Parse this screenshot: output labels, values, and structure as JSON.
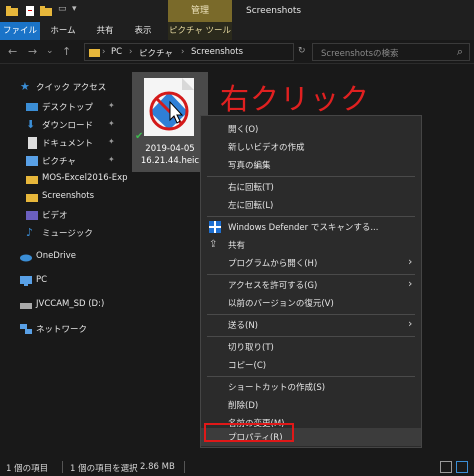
{
  "titlebar": {
    "manage_tab": "管理",
    "title": "Screenshots"
  },
  "ribbon_tabs": [
    "ファイル",
    "ホーム",
    "共有",
    "表示",
    "ピクチャ ツール"
  ],
  "address": {
    "path": [
      "PC",
      "ピクチャ",
      "Screenshots"
    ],
    "search_placeholder": "Screenshotsの検索"
  },
  "sidebar": {
    "items": [
      {
        "label": "クイック アクセス",
        "icon": "star-icon"
      },
      {
        "label": "デスクトップ",
        "icon": "desktop-icon",
        "pinned": "✦"
      },
      {
        "label": "ダウンロード",
        "icon": "download-icon",
        "pinned": "✦"
      },
      {
        "label": "ドキュメント",
        "icon": "document-icon",
        "pinned": "✦"
      },
      {
        "label": "ピクチャ",
        "icon": "pictures-icon",
        "pinned": "✦"
      },
      {
        "label": "MOS-Excel2016-Exp",
        "icon": "folder-icon"
      },
      {
        "label": "Screenshots",
        "icon": "folder-icon"
      },
      {
        "label": "ビデオ",
        "icon": "video-icon"
      },
      {
        "label": "ミュージック",
        "icon": "music-icon"
      },
      {
        "label": "OneDrive",
        "icon": "cloud-icon"
      },
      {
        "label": "PC",
        "icon": "pc-icon"
      },
      {
        "label": "JVCCAM_SD (D:)",
        "icon": "drive-icon"
      },
      {
        "label": "ネットワーク",
        "icon": "network-icon"
      }
    ]
  },
  "file": {
    "name_line1": "2019-04-05",
    "name_line2": "16.21.44.heic"
  },
  "annotation": "右クリック",
  "context_menu": {
    "items": [
      {
        "label": "開く(O)"
      },
      {
        "label": "新しいビデオの作成"
      },
      {
        "label": "写真の編集"
      },
      {
        "label": "右に回転(T)"
      },
      {
        "label": "左に回転(L)"
      },
      {
        "label": "Windows Defender でスキャンする...",
        "icon": "defender-icon"
      },
      {
        "label": "共有",
        "icon": "share-icon"
      },
      {
        "label": "プログラムから開く(H)",
        "submenu": "›"
      },
      {
        "label": "アクセスを許可する(G)",
        "submenu": "›"
      },
      {
        "label": "以前のバージョンの復元(V)"
      },
      {
        "label": "送る(N)",
        "submenu": "›"
      },
      {
        "label": "切り取り(T)"
      },
      {
        "label": "コピー(C)"
      },
      {
        "label": "ショートカットの作成(S)"
      },
      {
        "label": "削除(D)"
      },
      {
        "label": "名前の変更(M)"
      },
      {
        "label": "プロパティ(R)"
      }
    ]
  },
  "status": {
    "count": "1 個の項目",
    "selected": "1 個の項目を選択",
    "size": "2.86 MB"
  },
  "colors": {
    "accent": "#1a73c8",
    "highlight": "#e01818",
    "annotation": "#e02020",
    "manage": "#7a6a2a"
  }
}
